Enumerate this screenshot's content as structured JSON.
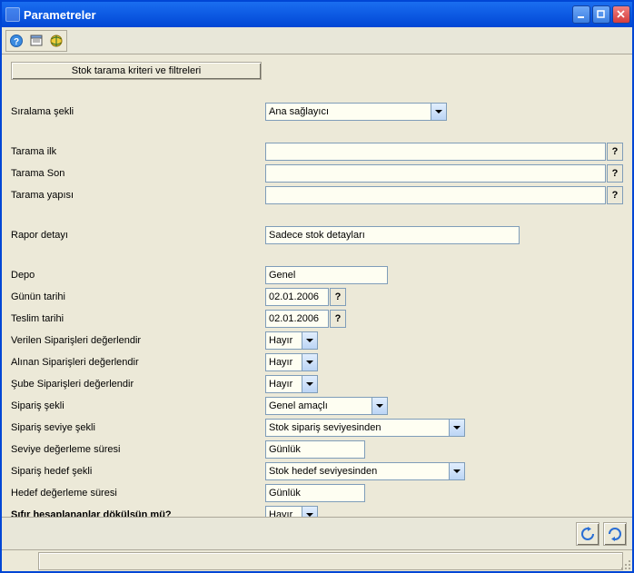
{
  "window": {
    "title": "Parametreler"
  },
  "filter_button_label": "Stok tarama kriteri ve filtreleri",
  "labels": {
    "sort_order": "Sıralama şekli",
    "scan_first": "Tarama ilk",
    "scan_last": "Tarama Son",
    "scan_structure": "Tarama yapısı",
    "report_detail": "Rapor detayı",
    "warehouse": "Depo",
    "day_date": "Günün tarihi",
    "delivery_date": "Teslim tarihi",
    "eval_given_orders": "Verilen Siparişleri değerlendir",
    "eval_received_orders": "Alınan Siparişleri değerlendir",
    "eval_branch_orders": "Şube Siparişleri değerlendir",
    "order_type": "Sipariş şekli",
    "order_level_type": "Sipariş seviye şekli",
    "level_eval_period": "Seviye değerleme süresi",
    "order_target_type": "Sipariş hedef şekli",
    "target_eval_period": "Hedef değerleme süresi",
    "dump_zero_calc": "Sıfır hesaplananlar dökülsün mü?"
  },
  "values": {
    "sort_order": "Ana sağlayıcı",
    "scan_first": "",
    "scan_last": "",
    "scan_structure": "",
    "report_detail": "Sadece stok detayları",
    "warehouse": "Genel",
    "day_date": "02.01.2006",
    "delivery_date": "02.01.2006",
    "eval_given_orders": "Hayır",
    "eval_received_orders": "Hayır",
    "eval_branch_orders": "Hayır",
    "order_type": "Genel amaçlı",
    "order_level_type": "Stok sipariş seviyesinden",
    "level_eval_period": "Günlük",
    "order_target_type": "Stok hedef seviyesinden",
    "target_eval_period": "Günlük",
    "dump_zero_calc": "Hayır"
  },
  "icons": {
    "help": "?",
    "lookup": "?"
  }
}
